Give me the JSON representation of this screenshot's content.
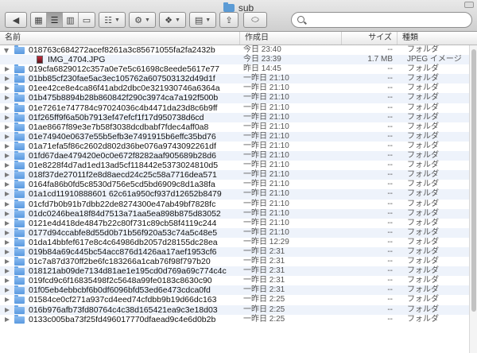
{
  "window": {
    "title": "sub"
  },
  "search": {
    "placeholder": "",
    "value": ""
  },
  "columns": {
    "name": "名前",
    "date": "作成日",
    "size": "サイズ",
    "kind": "種類"
  },
  "rows": [
    {
      "name": "018763c684272acef8261a3c85671055fa2fa2432b",
      "date": "今日 23:40",
      "size": "--",
      "kind": "フォルダ",
      "open": true
    },
    {
      "name": "IMG_4704.JPG",
      "date": "今日 23:39",
      "size": "1.7 MB",
      "kind": "JPEG イメージ",
      "child": true
    },
    {
      "name": "019cfa6829012c357a0e7e5c61698c8eede5617e77",
      "date": "昨日 14:45",
      "size": "--",
      "kind": "フォルダ"
    },
    {
      "name": "01bb85cf230fae5ac3ec105762a607503132d49d1f",
      "date": "一昨日 21:10",
      "size": "--",
      "kind": "フォルダ"
    },
    {
      "name": "01ee42ce8e4ca86f41abd2dbc0e321930746a6364a",
      "date": "一昨日 21:10",
      "size": "--",
      "kind": "フォルダ"
    },
    {
      "name": "01b475b8894b28b860842f290c3974ca7a192f500b",
      "date": "一昨日 21:10",
      "size": "--",
      "kind": "フォルダ"
    },
    {
      "name": "01e7261e747784c97024036c4b4471da23d8c6b9ff",
      "date": "一昨日 21:10",
      "size": "--",
      "kind": "フォルダ"
    },
    {
      "name": "01f265ff9f6a50b7913ef47efcf1f17d950738d6cd",
      "date": "一昨日 21:10",
      "size": "--",
      "kind": "フォルダ"
    },
    {
      "name": "01ae8667f89e3e7b58f3038dcdbabf7fdec4aff0a8",
      "date": "一昨日 21:10",
      "size": "--",
      "kind": "フォルダ"
    },
    {
      "name": "01e74940e0637e55b5efb3e7491915b6effc35bd76",
      "date": "一昨日 21:10",
      "size": "--",
      "kind": "フォルダ"
    },
    {
      "name": "01a71efa5f86c2602d802d36be076a9743092261df",
      "date": "一昨日 21:10",
      "size": "--",
      "kind": "フォルダ"
    },
    {
      "name": "01fd67dae479420e0c0e672f8282aaf905689b28d6",
      "date": "一昨日 21:10",
      "size": "--",
      "kind": "フォルダ"
    },
    {
      "name": "01e8228f4d7ad1ed13ad5cf118442e5373024810d5",
      "date": "一昨日 21:10",
      "size": "--",
      "kind": "フォルダ"
    },
    {
      "name": "018f37de27011f2e8d8aecd24c25c58a7716dea571",
      "date": "一昨日 21:10",
      "size": "--",
      "kind": "フォルダ"
    },
    {
      "name": "0164fa86b0fd5c8530d756e5cd5bd6909c8d1a38fa",
      "date": "一昨日 21:10",
      "size": "--",
      "kind": "フォルダ"
    },
    {
      "name": "01a1cd11910888601 62c61a950cf937d12652b8479",
      "date": "一昨日 21:10",
      "size": "--",
      "kind": "フォルダ"
    },
    {
      "name": "01cfd7b0b91b7dbb22de8274300e47ab49bf7828fc",
      "date": "一昨日 21:10",
      "size": "--",
      "kind": "フォルダ"
    },
    {
      "name": "01dc0246bea18f84d7513a71aa5ea898b875d83052",
      "date": "一昨日 21:10",
      "size": "--",
      "kind": "フォルダ"
    },
    {
      "name": "0121e4d418de4847b22c80f731c89cb58f4119c244",
      "date": "一昨日 21:10",
      "size": "--",
      "kind": "フォルダ"
    },
    {
      "name": "0177d94ccabfe8d55d0b71b56f920a53c74a5c48e5",
      "date": "一昨日 21:10",
      "size": "--",
      "kind": "フォルダ"
    },
    {
      "name": "01da14bbfef617e8c4c64986db2057d28155dc28ea",
      "date": "一昨日 12:29",
      "size": "--",
      "kind": "フォルダ"
    },
    {
      "name": "019b84a69c445bc54acc876d1426aa17aef1953cf6",
      "date": "一昨日 2:31",
      "size": "--",
      "kind": "フォルダ"
    },
    {
      "name": "01c7a87d370ff2be6fc183266a1cab76f98f797b20",
      "date": "一昨日 2:31",
      "size": "--",
      "kind": "フォルダ"
    },
    {
      "name": "018121ab09de7134d81ae1e195cd0d769a69c774c4c",
      "date": "一昨日 2:31",
      "size": "--",
      "kind": "フォルダ"
    },
    {
      "name": "019fcd9c6f16835498f2c5648a99fe0183c8630c90",
      "date": "一昨日 2:31",
      "size": "--",
      "kind": "フォルダ"
    },
    {
      "name": "01f05eb4ebbcbf6b0df6096bfd53ed6e473cdca0fd",
      "date": "一昨日 2:31",
      "size": "--",
      "kind": "フォルダ"
    },
    {
      "name": "01584ce0cf271a937cd4eed74cfdbb9b19d66dc163",
      "date": "一昨日 2:25",
      "size": "--",
      "kind": "フォルダ"
    },
    {
      "name": "016b976afb73fd80764c4c38d165421ea9c3e18d03",
      "date": "一昨日 2:25",
      "size": "--",
      "kind": "フォルダ"
    },
    {
      "name": "0133c005ba73f25fd496017770dfaead9c4e6d0b2b",
      "date": "一昨日 2:25",
      "size": "--",
      "kind": "フォルダ"
    }
  ]
}
